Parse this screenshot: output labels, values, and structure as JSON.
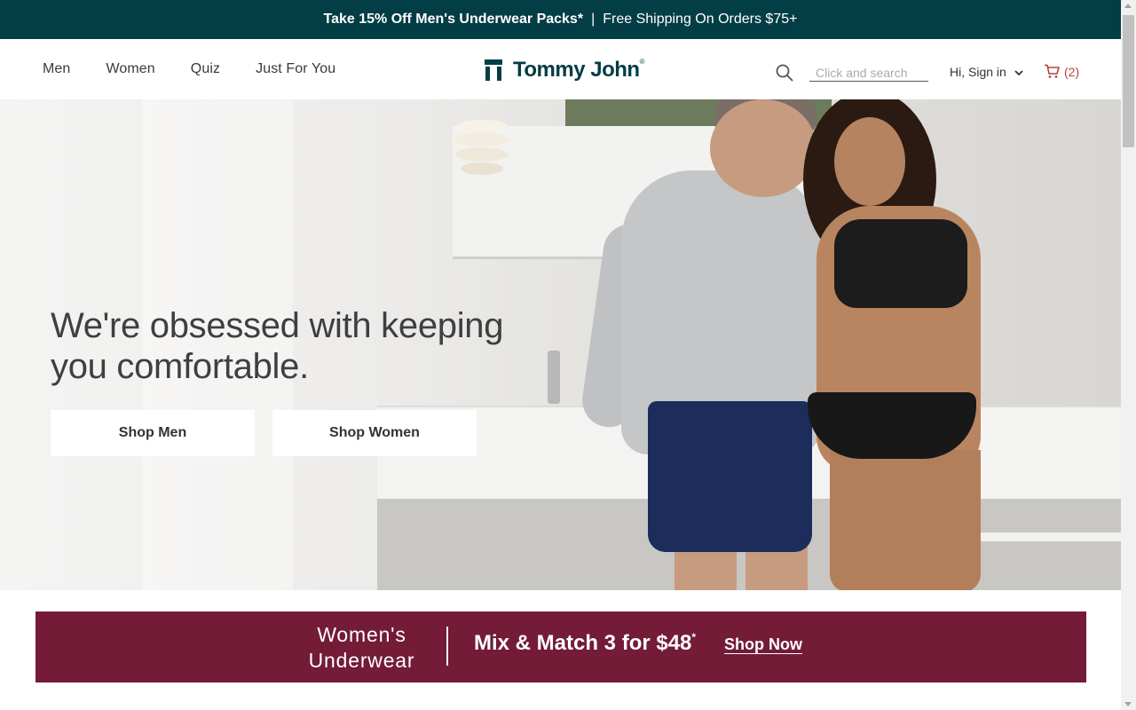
{
  "promo": {
    "offer": "Take 15% Off Men's Underwear Packs*",
    "separator": "|",
    "shipping": "Free Shipping On Orders $75+"
  },
  "nav": {
    "items": [
      {
        "label": "Men"
      },
      {
        "label": "Women"
      },
      {
        "label": "Quiz"
      },
      {
        "label": "Just For You"
      }
    ]
  },
  "brand": {
    "name": "Tommy John",
    "mark": "®",
    "color": "#033d45"
  },
  "header": {
    "search_placeholder": "Click and search",
    "signin_label": "Hi, Sign in",
    "cart_count": "(2)"
  },
  "hero": {
    "headline": "We're obsessed with keeping you comfortable.",
    "buttons": {
      "men": "Shop Men",
      "women": "Shop Women"
    }
  },
  "banner": {
    "title": "Women's Underwear",
    "offer": "Mix & Match 3 for $48",
    "offer_mark": "*",
    "cta": "Shop Now",
    "background": "#731b37"
  },
  "colors": {
    "promo_bg": "#033d45",
    "cart_accent": "#b8413b"
  }
}
